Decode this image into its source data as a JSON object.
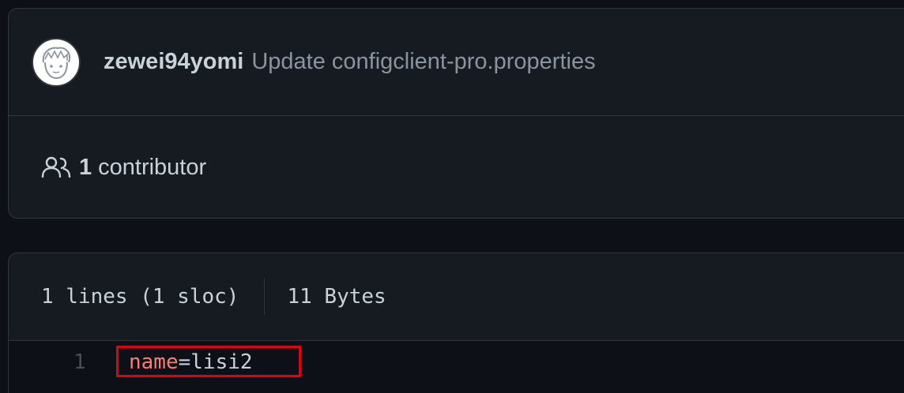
{
  "commit": {
    "author": "zewei94yomi",
    "message": "Update configclient-pro.properties",
    "avatar_icon": "avatar-icon"
  },
  "contributors": {
    "icon": "people-icon",
    "count": "1",
    "label": "contributor"
  },
  "file": {
    "lines_info": "1 lines (1 sloc)",
    "size": "11 Bytes",
    "code": [
      {
        "number": "1",
        "key": "name",
        "op": "=",
        "value": "lisi2"
      }
    ]
  },
  "colors": {
    "background": "#0d1117",
    "panel": "#161b22",
    "border": "#30363d",
    "key": "#ff7b72",
    "highlight_border": "#e5000f"
  }
}
